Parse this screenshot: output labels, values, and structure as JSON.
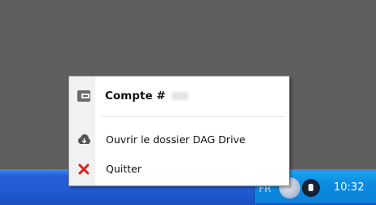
{
  "menu": {
    "header_label": "Compte #",
    "open_label": "Ouvrir le dossier DAG Drive",
    "quit_label": "Quitter"
  },
  "taskbar": {
    "language": "FR",
    "clock": "10:32"
  },
  "colors": {
    "desktop": "#5e5e5e",
    "taskbar_blue": "#215ad2",
    "tray_blue": "#0c8be0",
    "quit_red": "#e11d1d"
  }
}
